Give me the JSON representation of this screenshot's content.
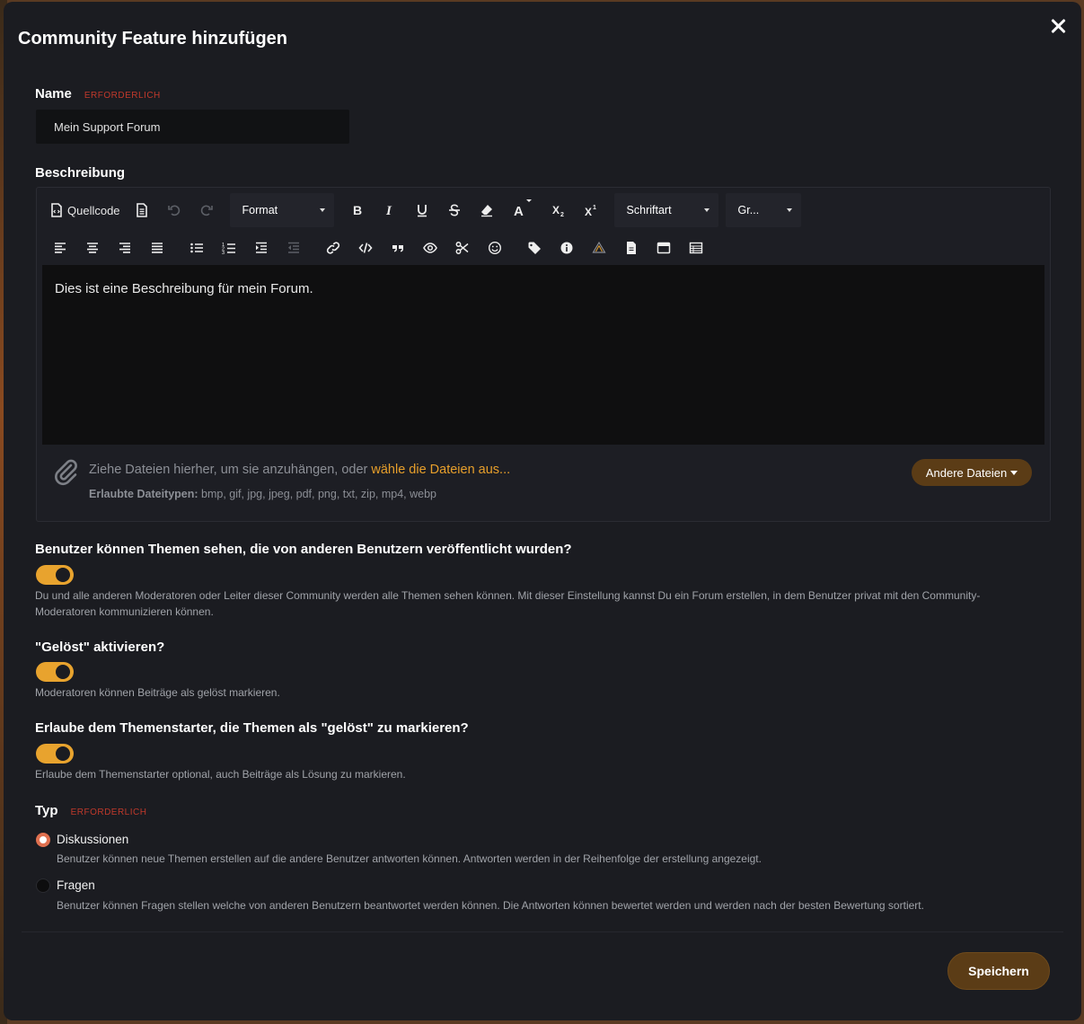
{
  "modal": {
    "title": "Community Feature hinzufügen"
  },
  "name_field": {
    "label": "Name",
    "required": "ERFORDERLICH",
    "value": "Mein Support Forum"
  },
  "description": {
    "label": "Beschreibung",
    "toolbar": {
      "source": "Quellcode",
      "format": "Format",
      "font": "Schriftart",
      "size": "Gr..."
    },
    "content": "Dies ist eine Beschreibung für mein Forum.",
    "attach": {
      "text": "Ziehe Dateien hierher, um sie anzuhängen, oder ",
      "link": "wähle die Dateien aus...",
      "types_label": "Erlaubte Dateitypen:",
      "types": " bmp, gif, jpg, jpeg, pdf, png, txt, zip, mp4, webp",
      "other_button": "Andere Dateien"
    }
  },
  "options": [
    {
      "title": "Benutzer können Themen sehen, die von anderen Benutzern veröffentlicht wurden?",
      "enabled": true,
      "desc": "Du und alle anderen Moderatoren oder Leiter dieser Community werden alle Themen sehen können. Mit dieser Einstellung kannst Du ein Forum erstellen, in dem Benutzer privat mit den Community-Moderatoren kommunizieren können."
    },
    {
      "title": "\"Gelöst\" aktivieren?",
      "enabled": true,
      "desc": "Moderatoren können Beiträge als gelöst markieren."
    },
    {
      "title": "Erlaube dem Themenstarter, die Themen als \"gelöst\" zu markieren?",
      "enabled": true,
      "desc": "Erlaube dem Themenstarter optional, auch Beiträge als Lösung zu markieren."
    }
  ],
  "type": {
    "label": "Typ",
    "required": "ERFORDERLICH",
    "choices": [
      {
        "label": "Diskussionen",
        "selected": true,
        "desc": "Benutzer können neue Themen erstellen auf die andere Benutzer antworten können. Antworten werden in der Reihenfolge der erstellung angezeigt."
      },
      {
        "label": "Fragen",
        "selected": false,
        "desc": "Benutzer können Fragen stellen welche von anderen Benutzern beantwortet werden können. Die Antworten können bewertet werden und werden nach der besten Bewertung sortiert."
      }
    ]
  },
  "save_label": "Speichern",
  "colors": {
    "accent": "#e8a32e",
    "button": "#5b3c16",
    "required": "#c0392b",
    "link": "#e79f2b"
  }
}
